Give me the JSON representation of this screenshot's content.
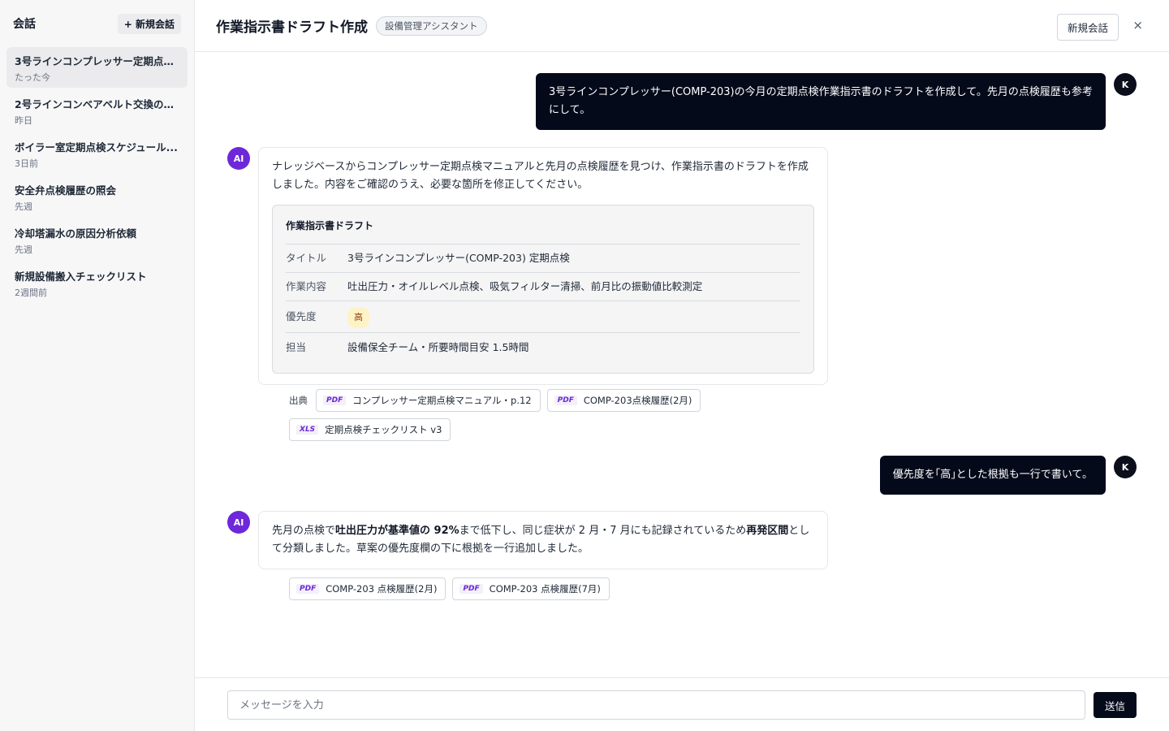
{
  "sidebar": {
    "title": "会話",
    "new_label": "+ 新規会話",
    "items": [
      {
        "title": "3号ラインコンプレッサー定期点検...",
        "time": "たった今"
      },
      {
        "title": "2号ラインコンベアベルト交換の問...",
        "time": "昨日"
      },
      {
        "title": "ボイラー室定期点検スケジュール...",
        "time": "3日前"
      },
      {
        "title": "安全弁点検履歴の照会",
        "time": "先週"
      },
      {
        "title": "冷却塔漏水の原因分析依頼",
        "time": "先週"
      },
      {
        "title": "新規設備搬入チェックリスト",
        "time": "2週間前"
      }
    ]
  },
  "header": {
    "title": "作業指示書ドラフト作成",
    "badge": "設備管理アシスタント",
    "new_label": "新規会話",
    "close": "×"
  },
  "messages": {
    "user_avatar": "K",
    "ai_avatar": "AI",
    "m1": "3号ラインコンプレッサー(COMP-203)の今月の定期点検作業指示書のドラフトを作成して。先月の点検履歴も参考にして。",
    "m2": "ナレッジベースからコンプレッサー定期点検マニュアルと先月の点検履歴を見つけ、作業指示書のドラフトを作成しました。内容をご確認のうえ、必要な箇所を修正してください。",
    "draft": {
      "title": "作業指示書ドラフト",
      "rows": [
        {
          "key": "タイトル",
          "value": "3号ラインコンプレッサー(COMP-203) 定期点検"
        },
        {
          "key": "作業内容",
          "value": "吐出圧力・オイルレベル点検、吸気フィルター清掃、前月比の振動値比較測定"
        },
        {
          "key": "優先度",
          "value": "高"
        },
        {
          "key": "担当",
          "value": "設備保全チーム・所要時間目安 1.5時間"
        }
      ]
    },
    "sources_label": "出典",
    "sources1": [
      {
        "type": "PDF",
        "name": "コンプレッサー定期点検マニュアル・p.12"
      },
      {
        "type": "PDF",
        "name": "COMP-203点検履歴(2月)"
      },
      {
        "type": "XLS",
        "name": "定期点検チェックリスト v3"
      }
    ],
    "m3": "優先度を｢高｣とした根拠も一行で書いて。",
    "m4": {
      "p1": "先月の点検で",
      "b1": "吐出圧力が基準値の 92%",
      "p2": "まで低下し、同じ症状が 2 月・7 月にも記録されているため",
      "b2": "再発区間",
      "p3": "として分類しました。草案の優先度欄の下に根拠を一行追加しました。"
    },
    "sources2": [
      {
        "type": "PDF",
        "name": "COMP-203 点検履歴(2月)"
      },
      {
        "type": "PDF",
        "name": "COMP-203 点検履歴(7月)"
      }
    ]
  },
  "composer": {
    "placeholder": "メッセージを入力",
    "send_label": "送信"
  }
}
